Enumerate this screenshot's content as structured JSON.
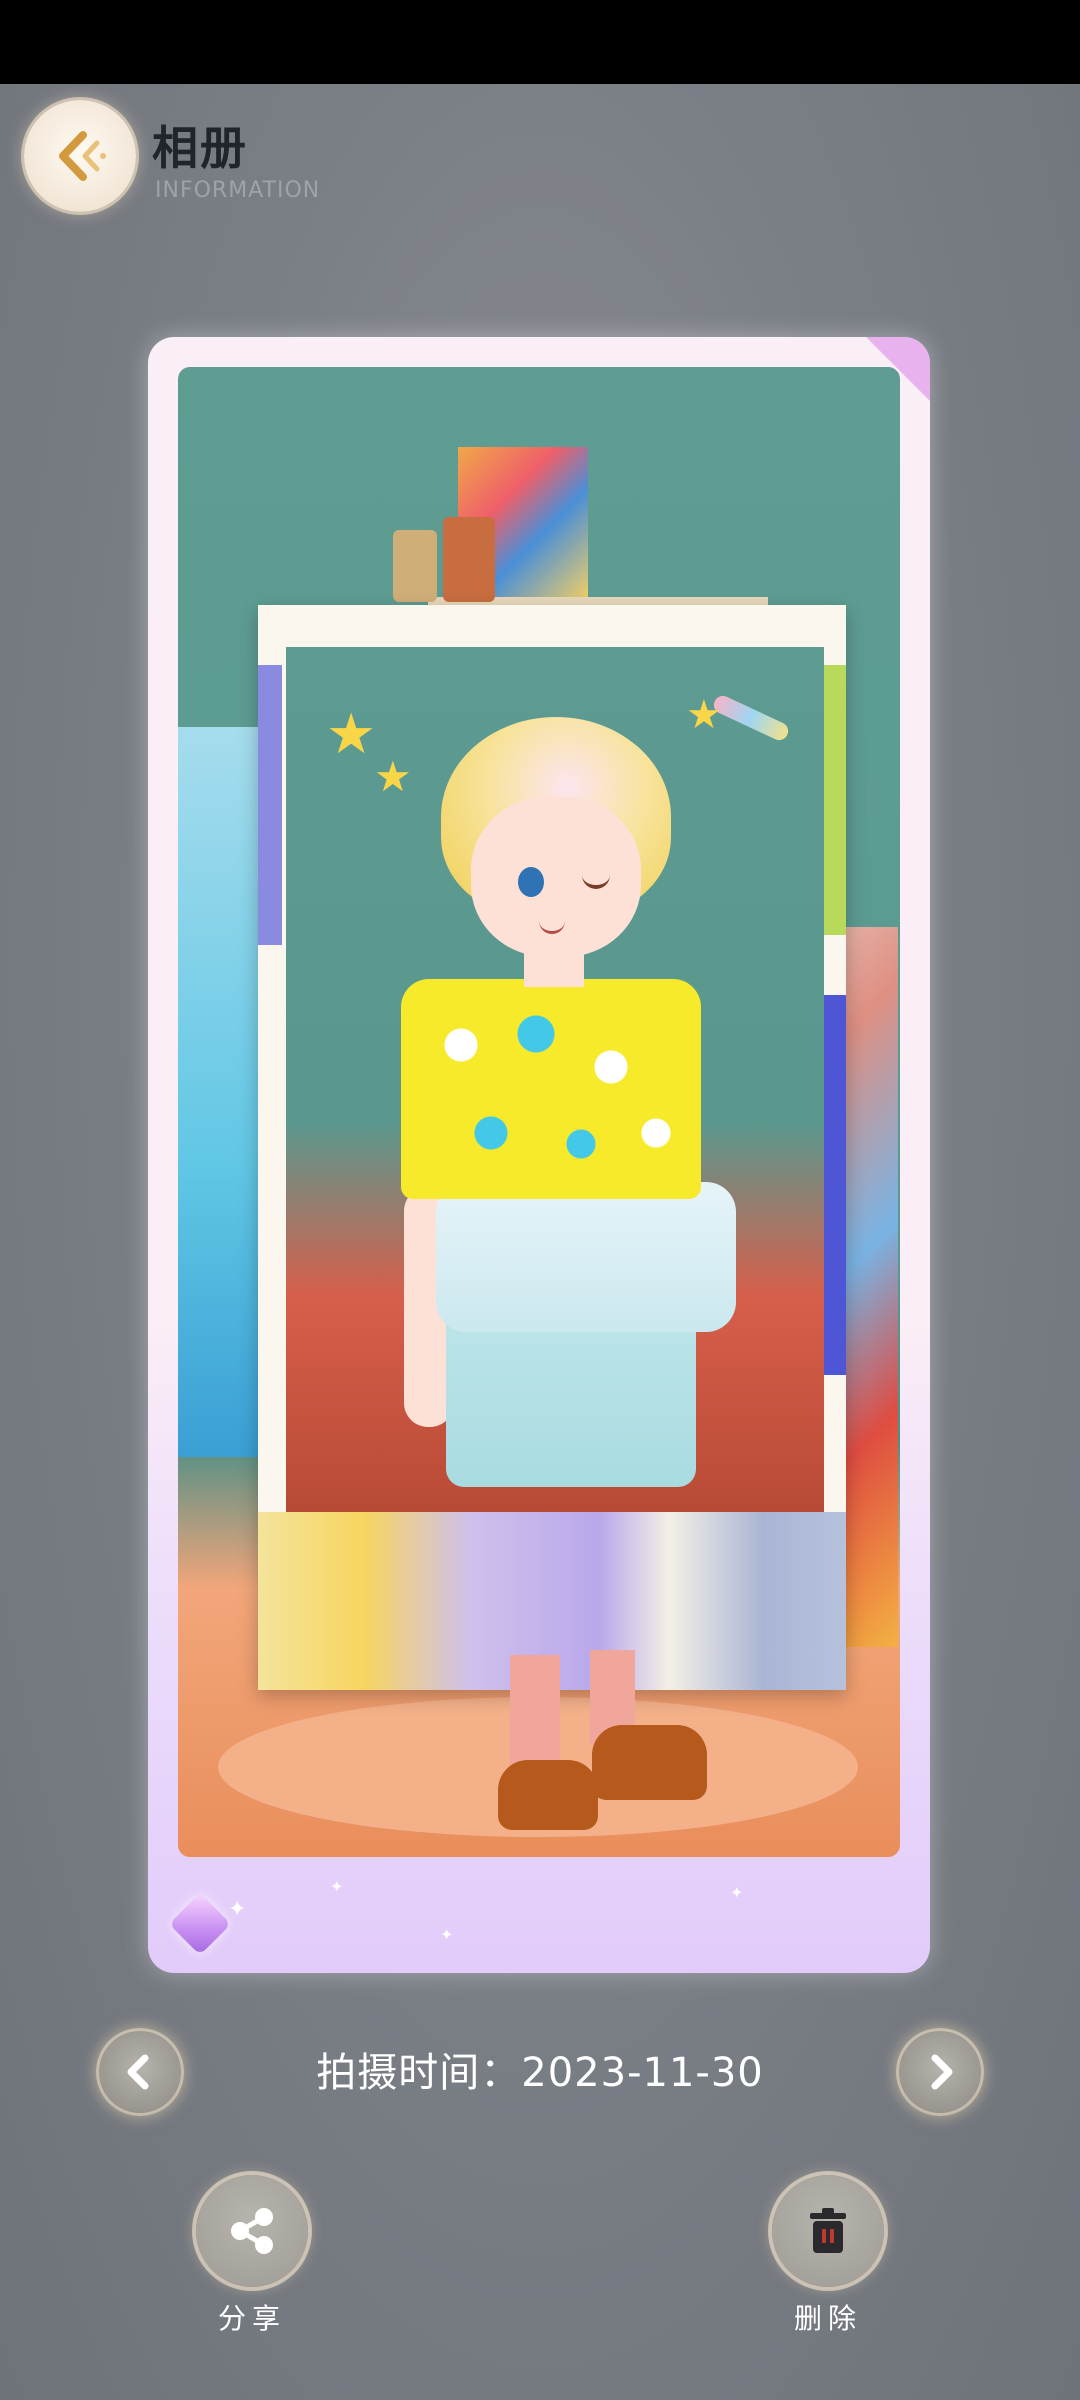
{
  "header": {
    "title": "相册",
    "subtitle": "INFORMATION"
  },
  "photo": {
    "date_label": "拍摄时间：",
    "date_value": "2023-11-30"
  },
  "actions": {
    "share_label": "分享",
    "delete_label": "删除"
  },
  "icons": {
    "back": "back-chevron-icon",
    "prev": "chevron-left-icon",
    "next": "chevron-right-icon",
    "share": "share-icon",
    "delete": "trash-icon"
  },
  "colors": {
    "background": "#7b7f86",
    "card_frame": "#fbeef6",
    "button_glow": "#ffe6be",
    "trash_accent": "#c0392b"
  }
}
